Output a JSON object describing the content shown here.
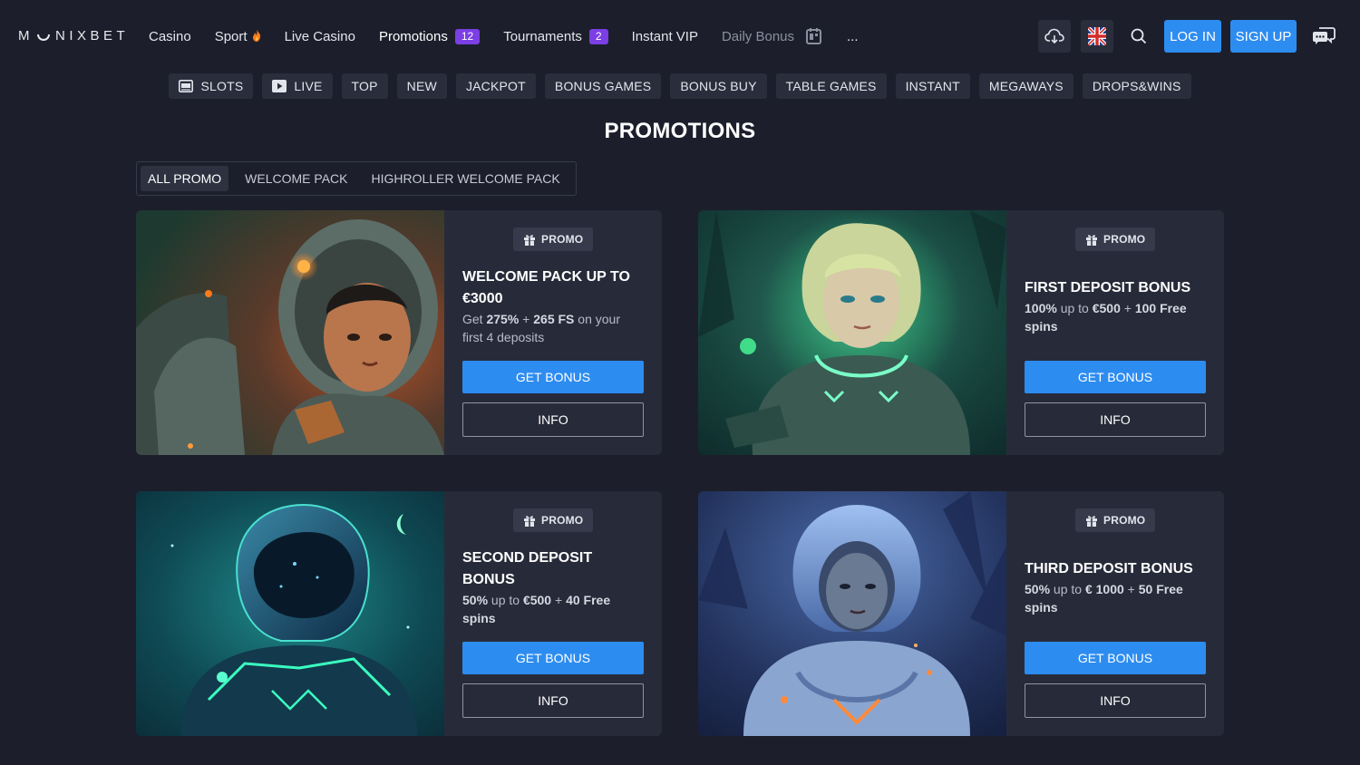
{
  "brand": {
    "logo_left": "M",
    "logo_right": "NIXBET"
  },
  "nav": {
    "items": [
      {
        "label": "Casino"
      },
      {
        "label": "Sport"
      },
      {
        "label": "Live Casino"
      },
      {
        "label": "Promotions",
        "badge": "12"
      },
      {
        "label": "Tournaments",
        "badge": "2"
      },
      {
        "label": "Instant VIP"
      },
      {
        "label": "Daily Bonus"
      },
      {
        "label": "..."
      }
    ]
  },
  "header": {
    "login_label": "LOG IN",
    "signup_label": "SIGN UP",
    "icons": [
      "cloud-download-icon",
      "uk-flag-icon",
      "search-icon",
      "chat-icon"
    ]
  },
  "categories": [
    {
      "label": "SLOTS",
      "icon": "slot-machine-icon"
    },
    {
      "label": "LIVE",
      "icon": "play-icon"
    },
    {
      "label": "TOP"
    },
    {
      "label": "NEW"
    },
    {
      "label": "JACKPOT"
    },
    {
      "label": "BONUS GAMES"
    },
    {
      "label": "BONUS BUY"
    },
    {
      "label": "TABLE GAMES"
    },
    {
      "label": "INSTANT"
    },
    {
      "label": "MEGAWAYS"
    },
    {
      "label": "DROPS&WINS"
    }
  ],
  "page_title": "PROMOTIONS",
  "tabs": [
    {
      "label": "ALL PROMO",
      "active": true
    },
    {
      "label": "WELCOME PACK"
    },
    {
      "label": "HIGHROLLER WELCOME PACK"
    }
  ],
  "promos": [
    {
      "tag": "PROMO",
      "title": "WELCOME PACK UP TO €3000",
      "desc_parts": [
        "Get ",
        "275%",
        " + ",
        "265 FS",
        " on your first 4 deposits"
      ],
      "get_label": "GET BONUS",
      "info_label": "INFO"
    },
    {
      "tag": "PROMO",
      "title": "FIRST DEPOSIT BONUS",
      "desc_parts": [
        "100%",
        " up to ",
        "€500",
        " + ",
        "100 Free spins"
      ],
      "get_label": "GET BONUS",
      "info_label": "INFO"
    },
    {
      "tag": "PROMO",
      "title": "SECOND DEPOSIT BONUS",
      "desc_parts": [
        "50%",
        " up to ",
        "€500",
        " + ",
        "40 Free spins"
      ],
      "get_label": "GET BONUS",
      "info_label": "INFO"
    },
    {
      "tag": "PROMO",
      "title": "THIRD DEPOSIT BONUS",
      "desc_parts": [
        "50%",
        " up to ",
        "€ 1000",
        " + ",
        "50 Free spins"
      ],
      "get_label": "GET BONUS",
      "info_label": "INFO"
    }
  ],
  "colors": {
    "background": "#1c1f2b",
    "card": "#272b39",
    "accent_blue": "#2d8cf0",
    "badge_purple": "#7b3fe4"
  }
}
